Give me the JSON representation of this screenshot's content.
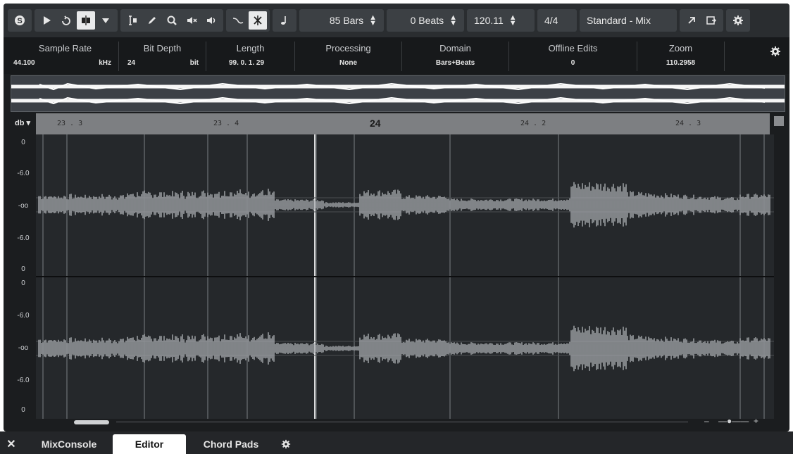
{
  "toolbar": {
    "bars": "85 Bars",
    "beats": "0 Beats",
    "tempo": "120.11",
    "signature": "4/4",
    "preset": "Standard - Mix",
    "icons": [
      "snap-icon",
      "play-icon",
      "loop-icon",
      "split-tool-icon",
      "chevron-down-icon",
      "range-tool-icon",
      "pencil-icon",
      "zoom-icon",
      "mute-icon",
      "speaker-icon",
      "warp-icon",
      "hitpoint-icon",
      "metronome-icon",
      "export-icon",
      "window-icon",
      "gear-icon"
    ]
  },
  "infoline": {
    "cells": [
      {
        "label": "Sample Rate",
        "value": "44.100",
        "unit": "kHz"
      },
      {
        "label": "Bit Depth",
        "value": "24",
        "unit": "bit"
      },
      {
        "label": "Length",
        "value": "99. 0. 1. 29",
        "unit": ""
      },
      {
        "label": "Processing",
        "value": "None",
        "unit": ""
      },
      {
        "label": "Domain",
        "value": "Bars+Beats",
        "unit": ""
      },
      {
        "label": "Offline Edits",
        "value": "0",
        "unit": ""
      },
      {
        "label": "Zoom",
        "value": "110.2958",
        "unit": ""
      }
    ]
  },
  "ruler": {
    "unit_label": "db",
    "ticks": [
      "23 . 3",
      "23 . 4",
      "24",
      "24 . 2",
      "24 . 3"
    ]
  },
  "db_scale": [
    "0",
    "-6.0",
    "-oo",
    "-6.0",
    "0",
    "0",
    "-6.0",
    "-oo",
    "-6.0",
    "0"
  ],
  "tabs": [
    "MixConsole",
    "Editor",
    "Chord Pads"
  ],
  "active_tab": "Editor"
}
